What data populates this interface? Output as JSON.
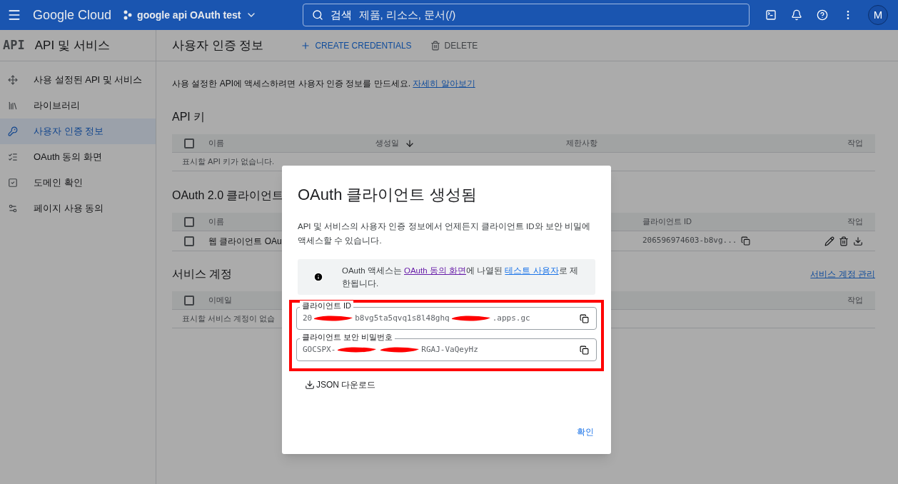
{
  "header": {
    "logo": "Google Cloud",
    "project": "google api OAuth test",
    "search": {
      "label": "검색",
      "placeholder": "제품, 리소스, 문서(/)"
    },
    "avatar": "M"
  },
  "sidebar": {
    "badge": "API",
    "title": "API 및 서비스",
    "items": [
      {
        "label": "사용 설정된 API 및 서비스",
        "selected": false
      },
      {
        "label": "라이브러리",
        "selected": false
      },
      {
        "label": "사용자 인증 정보",
        "selected": true
      },
      {
        "label": "OAuth 동의 화면",
        "selected": false
      },
      {
        "label": "도메인 확인",
        "selected": false
      },
      {
        "label": "페이지 사용 동의",
        "selected": false
      }
    ]
  },
  "main": {
    "title": "사용자 인증 정보",
    "actions": [
      {
        "kind": "create",
        "label": "CREATE CREDENTIALS"
      },
      {
        "kind": "delete",
        "label": "DELETE"
      }
    ],
    "description": {
      "text": "사용 설정한 API에 액세스하려면 사용자 인증 정보를 만드세요.",
      "link": "자세히 알아보기"
    },
    "api_keys": {
      "title": "API 키",
      "select_all_checked": false,
      "columns": [
        "이름",
        "생성일",
        "제한사항",
        "작업"
      ],
      "empty": "표시할 API 키가 없습니다."
    },
    "oauth_clients": {
      "title": "OAuth 2.0 클라이언트",
      "select_all_checked": false,
      "columns": [
        "이름",
        "클라이언트 ID",
        "작업"
      ],
      "rows": [
        {
          "name": "웹 클라이언트 OAu",
          "client_id": "206596974603-b8vg...",
          "checked": false
        }
      ]
    },
    "service_accounts": {
      "title": "서비스 계정",
      "select_all_checked": false,
      "link": "서비스 계정 관리",
      "columns": [
        "이메일",
        "작업"
      ],
      "empty": "표시할 서비스 계정이 없습"
    }
  },
  "dialog": {
    "title": "OAuth 클라이언트 생성됨",
    "body": "API 및 서비스의 사용자 인증 정보에서 언제든지 클라이언트 ID와 보안 비밀에 액세스할 수 있습니다.",
    "notice": [
      {
        "kind": "text",
        "text": "OAuth 액세스는 "
      },
      {
        "kind": "visited_link",
        "text": "OAuth 동의 화면"
      },
      {
        "kind": "text",
        "text": "에 나열된 "
      },
      {
        "kind": "link",
        "text": "테스트 사용자"
      },
      {
        "kind": "text",
        "text": "로 제한됩니다."
      }
    ],
    "fields": [
      {
        "label": "클라이언트 ID",
        "segments": [
          {
            "kind": "text",
            "text": "20"
          },
          {
            "kind": "redaction"
          },
          {
            "kind": "text",
            "text": "b8vg5ta5qvq1s8l48ghq"
          },
          {
            "kind": "redaction"
          },
          {
            "kind": "text",
            "text": ".apps.gc"
          }
        ]
      },
      {
        "label": "클라이언트 보안 비밀번호",
        "segments": [
          {
            "kind": "text",
            "text": "GOCSPX-"
          },
          {
            "kind": "redaction"
          },
          {
            "kind": "redaction"
          },
          {
            "kind": "text",
            "text": "RGAJ-VaQeyHz"
          }
        ]
      }
    ],
    "download": "JSON 다운로드",
    "confirm": "확인"
  }
}
